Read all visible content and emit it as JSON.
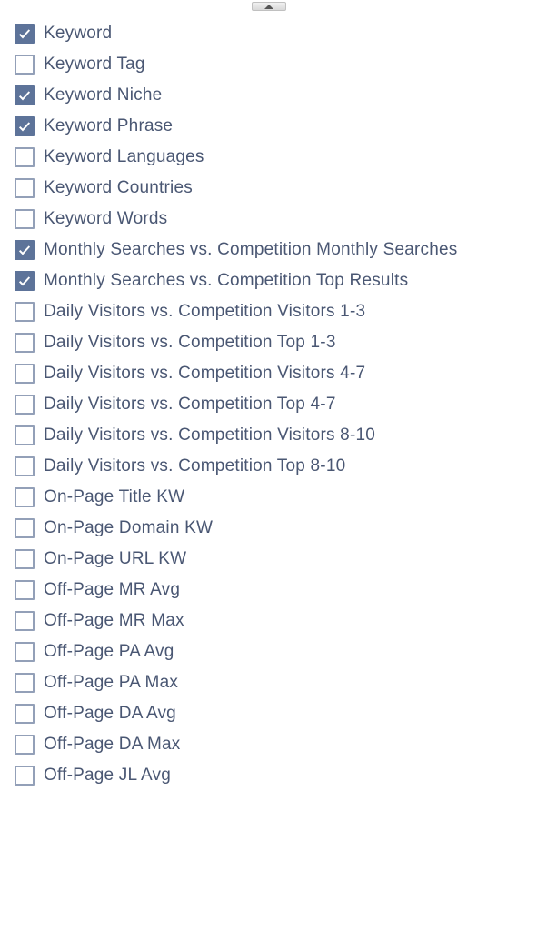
{
  "options": [
    {
      "label": "Keyword",
      "checked": true
    },
    {
      "label": "Keyword Tag",
      "checked": false
    },
    {
      "label": "Keyword Niche",
      "checked": true
    },
    {
      "label": "Keyword Phrase",
      "checked": true
    },
    {
      "label": "Keyword Languages",
      "checked": false
    },
    {
      "label": "Keyword Countries",
      "checked": false
    },
    {
      "label": "Keyword Words",
      "checked": false
    },
    {
      "label": "Monthly Searches vs. Competition Monthly Searches",
      "checked": true
    },
    {
      "label": "Monthly Searches vs. Competition Top Results",
      "checked": true
    },
    {
      "label": "Daily Visitors vs. Competition Visitors 1-3",
      "checked": false
    },
    {
      "label": "Daily Visitors vs. Competition Top 1-3",
      "checked": false
    },
    {
      "label": "Daily Visitors vs. Competition Visitors 4-7",
      "checked": false
    },
    {
      "label": "Daily Visitors vs. Competition Top 4-7",
      "checked": false
    },
    {
      "label": "Daily Visitors vs. Competition Visitors 8-10",
      "checked": false
    },
    {
      "label": "Daily Visitors vs. Competition Top 8-10",
      "checked": false
    },
    {
      "label": "On-Page Title KW",
      "checked": false
    },
    {
      "label": "On-Page Domain KW",
      "checked": false
    },
    {
      "label": "On-Page URL KW",
      "checked": false
    },
    {
      "label": "Off-Page MR Avg",
      "checked": false
    },
    {
      "label": "Off-Page MR Max",
      "checked": false
    },
    {
      "label": "Off-Page PA Avg",
      "checked": false
    },
    {
      "label": "Off-Page PA Max",
      "checked": false
    },
    {
      "label": "Off-Page DA Avg",
      "checked": false
    },
    {
      "label": "Off-Page DA Max",
      "checked": false
    },
    {
      "label": "Off-Page JL Avg",
      "checked": false
    }
  ]
}
